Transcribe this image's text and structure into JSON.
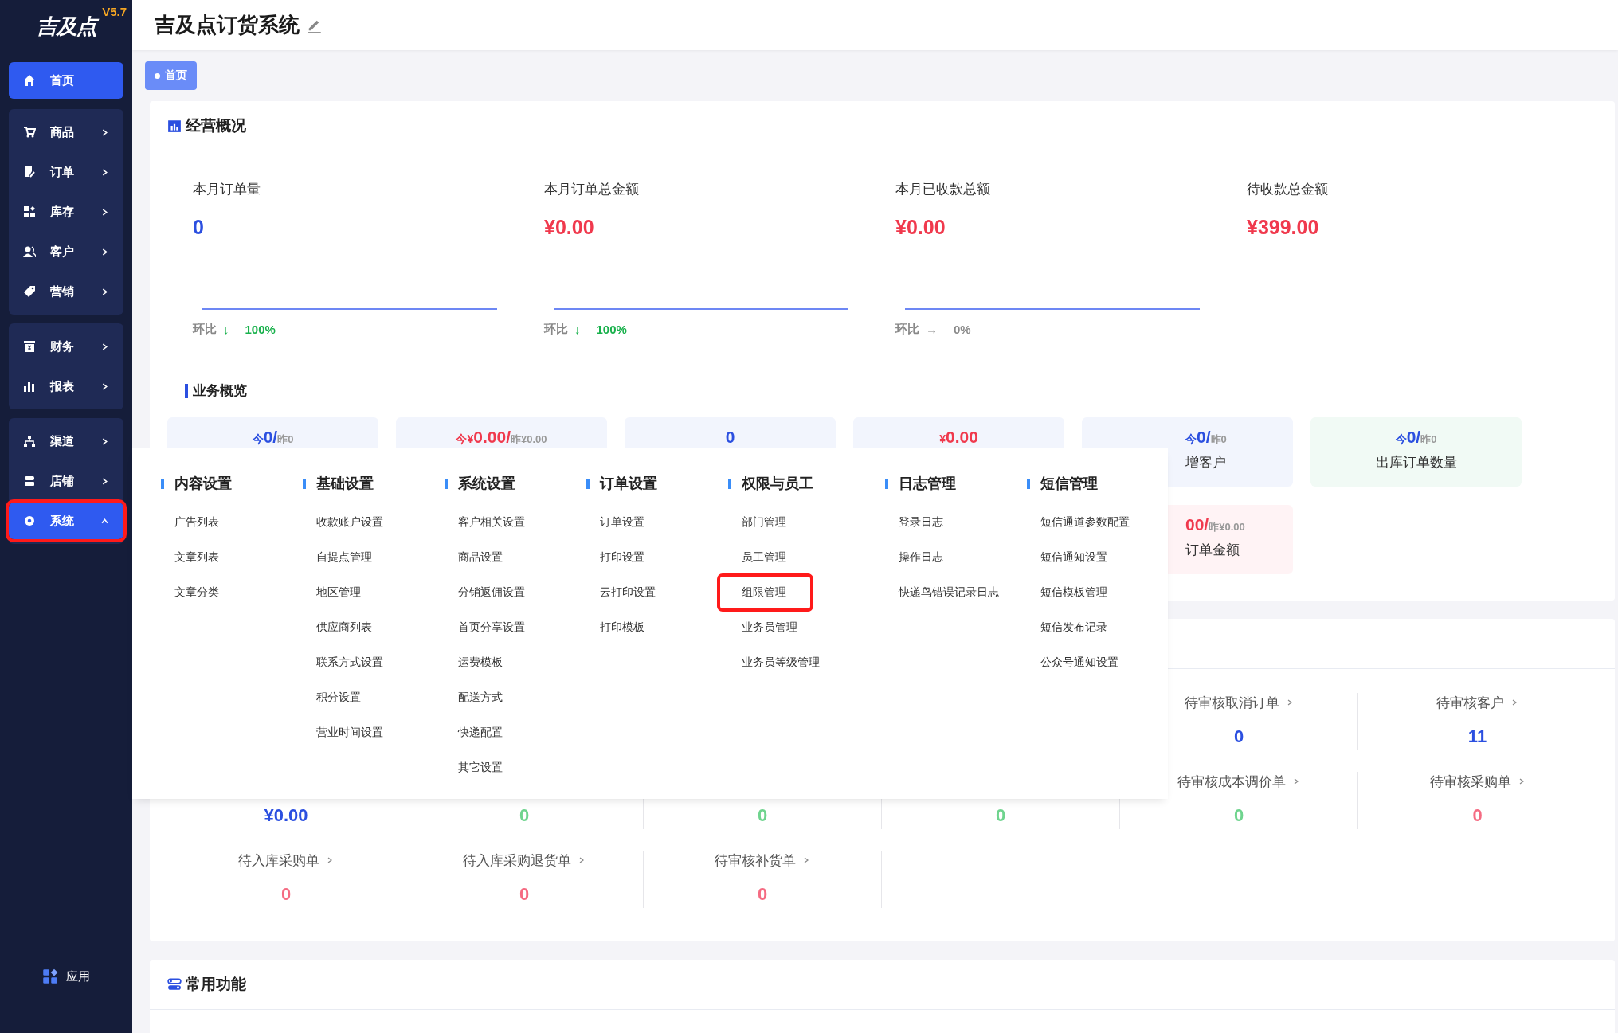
{
  "logo": {
    "text": "吉及点",
    "version": "V5.7"
  },
  "sidebar": {
    "groups": [
      {
        "items": [
          {
            "label": "首页",
            "kind": "link",
            "selected": true,
            "marked": false
          }
        ]
      },
      {
        "items": [
          {
            "label": "商品",
            "kind": "menu",
            "selected": false,
            "expanded": false,
            "marked": false
          },
          {
            "label": "订单",
            "kind": "menu",
            "selected": false,
            "expanded": false,
            "marked": false
          },
          {
            "label": "库存",
            "kind": "menu",
            "selected": false,
            "expanded": false,
            "marked": false
          },
          {
            "label": "客户",
            "kind": "menu",
            "selected": false,
            "expanded": false,
            "marked": false
          },
          {
            "label": "营销",
            "kind": "menu",
            "selected": false,
            "expanded": false,
            "marked": false
          }
        ]
      },
      {
        "items": [
          {
            "label": "财务",
            "kind": "menu",
            "selected": false,
            "expanded": false,
            "marked": false
          },
          {
            "label": "报表",
            "kind": "menu",
            "selected": false,
            "expanded": false,
            "marked": false
          }
        ]
      },
      {
        "items": [
          {
            "label": "渠道",
            "kind": "menu",
            "selected": false,
            "expanded": false,
            "marked": false
          },
          {
            "label": "店铺",
            "kind": "menu",
            "selected": false,
            "expanded": false,
            "marked": false
          },
          {
            "label": "系统",
            "kind": "menu",
            "selected": true,
            "expanded": true,
            "marked": true
          }
        ]
      }
    ],
    "apps": {
      "label": "应用"
    }
  },
  "header": {
    "title": "吉及点订货系统"
  },
  "tabs": [
    {
      "label": "首页",
      "selected": true
    }
  ],
  "overview": {
    "title": "经营概况",
    "stats": [
      {
        "label": "本月订单量",
        "value": "0",
        "color": "#2b4fe0",
        "trend": {
          "label": "环比",
          "arrow": "↓",
          "percent": "100%",
          "color": "#19b14c"
        }
      },
      {
        "label": "本月订单总金额",
        "value": "¥0.00",
        "color": "#f0394d",
        "trend": {
          "label": "环比",
          "arrow": "↓",
          "percent": "100%",
          "color": "#19b14c"
        }
      },
      {
        "label": "本月已收款总额",
        "value": "¥0.00",
        "color": "#f0394d",
        "trend": {
          "label": "环比",
          "arrow": "→",
          "percent": "0%",
          "color": "#8a8a8a"
        }
      },
      {
        "label": "待收款总金额",
        "value": "¥399.00",
        "color": "#f0394d"
      }
    ]
  },
  "business": {
    "title": "业务概览",
    "rows": [
      [
        {
          "prefix": "今",
          "value": "0/",
          "yesterday": "昨0",
          "color": "#2b4fe0",
          "kind": "daily"
        },
        {
          "prefix": "今¥",
          "value": "0.00/",
          "yesterday": "昨¥0.00",
          "color": "#f0394d",
          "kind": "daily"
        },
        {
          "value": "0",
          "color": "#2b4fe0",
          "kind": "daily"
        },
        {
          "prefix": "¥",
          "value": "0.00",
          "color": "#f0394d",
          "kind": "daily"
        },
        {
          "prefix": "今",
          "value": "0/",
          "yesterday": "昨0",
          "label": "增客户",
          "color": "#2b4fe0",
          "kind": "daily"
        },
        {
          "prefix": "今",
          "value": "0/",
          "yesterday": "昨0",
          "label": "出库订单数量",
          "color": "#2b4fe0",
          "kind": "outbound"
        }
      ],
      [
        "",
        "",
        "",
        "",
        {
          "value": "00/",
          "yesterday": "昨¥0.00",
          "label": "订单金额",
          "color": "#f0394d",
          "kind": "amount"
        }
      ]
    ]
  },
  "pending": {
    "rows": [
      [
        "",
        "",
        "",
        "",
        {
          "label": "待审核取消订单",
          "value": "0",
          "color": "#2b4fe0"
        },
        {
          "label": "待审核客户",
          "value": "11",
          "color": "#2b4fe0"
        }
      ],
      [
        {
          "value": "¥0.00",
          "color": "#2b4fe0"
        },
        {
          "value": "0",
          "color": "#6fd48e"
        },
        {
          "value": "0",
          "color": "#6fd48e"
        },
        {
          "value": "0",
          "color": "#6fd48e"
        },
        {
          "label": "待审核成本调价单",
          "value": "0",
          "color": "#6fd48e"
        },
        {
          "label": "待审核采购单",
          "value": "0",
          "color": "#f56b82"
        }
      ],
      [
        {
          "label": "待入库采购单",
          "value": "0",
          "color": "#f56b82"
        },
        {
          "label": "待入库采购退货单",
          "value": "0",
          "color": "#f56b82"
        },
        {
          "label": "待审核补货单",
          "value": "0",
          "color": "#f56b82"
        }
      ]
    ]
  },
  "functions": {
    "title": "常用功能"
  },
  "menu": {
    "columns": [
      {
        "title": "内容设置",
        "items": [
          {
            "label": "广告列表",
            "marked": false
          },
          {
            "label": "文章列表",
            "marked": false
          },
          {
            "label": "文章分类",
            "marked": false
          }
        ]
      },
      {
        "title": "基础设置",
        "items": [
          {
            "label": "收款账户设置",
            "marked": false
          },
          {
            "label": "自提点管理",
            "marked": false
          },
          {
            "label": "地区管理",
            "marked": false
          },
          {
            "label": "供应商列表",
            "marked": false
          },
          {
            "label": "联系方式设置",
            "marked": false
          },
          {
            "label": "积分设置",
            "marked": false
          },
          {
            "label": "营业时间设置",
            "marked": false
          }
        ]
      },
      {
        "title": "系统设置",
        "items": [
          {
            "label": "客户相关设置",
            "marked": false
          },
          {
            "label": "商品设置",
            "marked": false
          },
          {
            "label": "分销返佣设置",
            "marked": false
          },
          {
            "label": "首页分享设置",
            "marked": false
          },
          {
            "label": "运费模板",
            "marked": false
          },
          {
            "label": "配送方式",
            "marked": false
          },
          {
            "label": "快递配置",
            "marked": false
          },
          {
            "label": "其它设置",
            "marked": false
          }
        ]
      },
      {
        "title": "订单设置",
        "items": [
          {
            "label": "订单设置",
            "marked": false
          },
          {
            "label": "打印设置",
            "marked": false
          },
          {
            "label": "云打印设置",
            "marked": false
          },
          {
            "label": "打印模板",
            "marked": false
          }
        ]
      },
      {
        "title": "权限与员工",
        "items": [
          {
            "label": "部门管理",
            "marked": false
          },
          {
            "label": "员工管理",
            "marked": false
          },
          {
            "label": "组限管理",
            "marked": true
          },
          {
            "label": "业务员管理",
            "marked": false
          },
          {
            "label": "业务员等级管理",
            "marked": false
          }
        ]
      },
      {
        "title": "日志管理",
        "items": [
          {
            "label": "登录日志",
            "marked": false
          },
          {
            "label": "操作日志",
            "marked": false
          },
          {
            "label": "快递鸟错误记录日志",
            "marked": false
          }
        ]
      },
      {
        "title": "短信管理",
        "items": [
          {
            "label": "短信通道参数配置",
            "marked": false
          },
          {
            "label": "短信通知设置",
            "marked": false
          },
          {
            "label": "短信模板管理",
            "marked": false
          },
          {
            "label": "短信发布记录",
            "marked": false
          },
          {
            "label": "公众号通知设置",
            "marked": false
          }
        ]
      }
    ]
  }
}
